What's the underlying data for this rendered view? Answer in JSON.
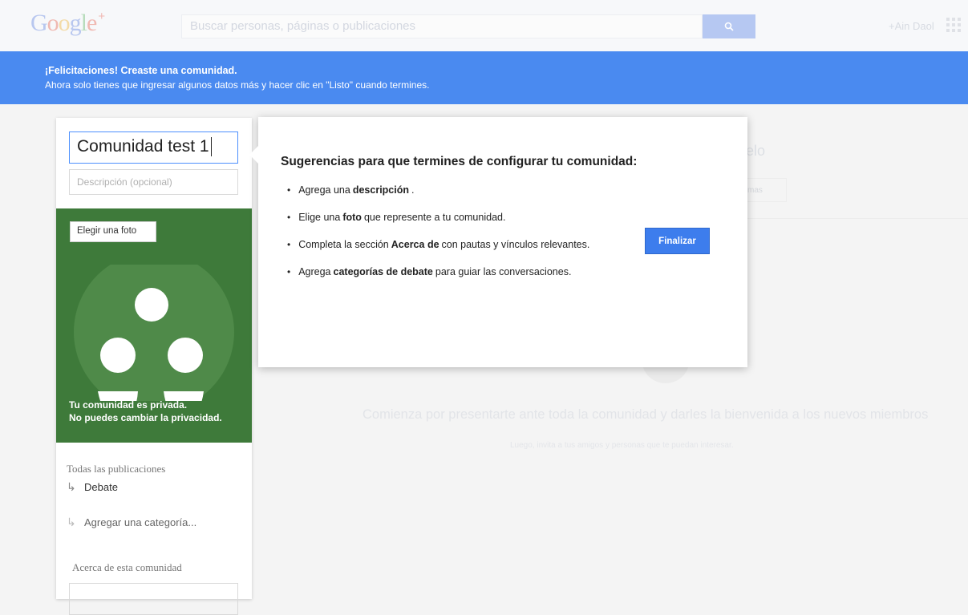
{
  "header": {
    "logo_text": "Google+",
    "search_placeholder": "Buscar personas, páginas o publicaciones",
    "user_name": "+Ain Daol"
  },
  "banner": {
    "title": "¡Felicitaciones! Creaste una comunidad.",
    "message": "Ahora solo tienes que ingresar algunos datos más y hacer clic en \"Listo\" cuando termines."
  },
  "community": {
    "name_value": "Comunidad test 1",
    "description_placeholder": "Descripción (opcional)",
    "choose_photo_label": "Elegir una foto",
    "privacy_line1": "Tu comunidad es privada.",
    "privacy_line2": "No puedes cambiar la privacidad.",
    "all_posts_label": "Todas las publicaciones",
    "categories": [
      "Debate"
    ],
    "add_category_label": "Agregar una categoría...",
    "about_label": "Acerca de esta comunidad"
  },
  "popup": {
    "title": "Sugerencias para que termines de configurar tu comunidad:",
    "tips": [
      {
        "before": "Agrega una",
        "bold": "descripción",
        "after": "."
      },
      {
        "before": "Elige una",
        "bold": "foto",
        "after": "que represente a tu comunidad."
      },
      {
        "before": "Completa la sección",
        "bold": "Acerca de",
        "after": "con pautas y vínculos relevantes."
      },
      {
        "before": "Agrega",
        "bold": "categorías de debate",
        "after": "para guiar las conversaciones."
      }
    ],
    "finish_label": "Finalizar"
  },
  "background": {
    "heading_fragment": "elo",
    "chip_text": "mas",
    "intro_line": "Comienza por presentarte ante toda la comunidad y darles la bienvenida a los nuevos miembros",
    "intro_sub": "Luego, invita a tus amigos y personas que te puedan interesar."
  },
  "colors": {
    "banner": "#4a8af0",
    "photo_panel": "#3e7a3a",
    "primary_button": "#3d7ded"
  }
}
